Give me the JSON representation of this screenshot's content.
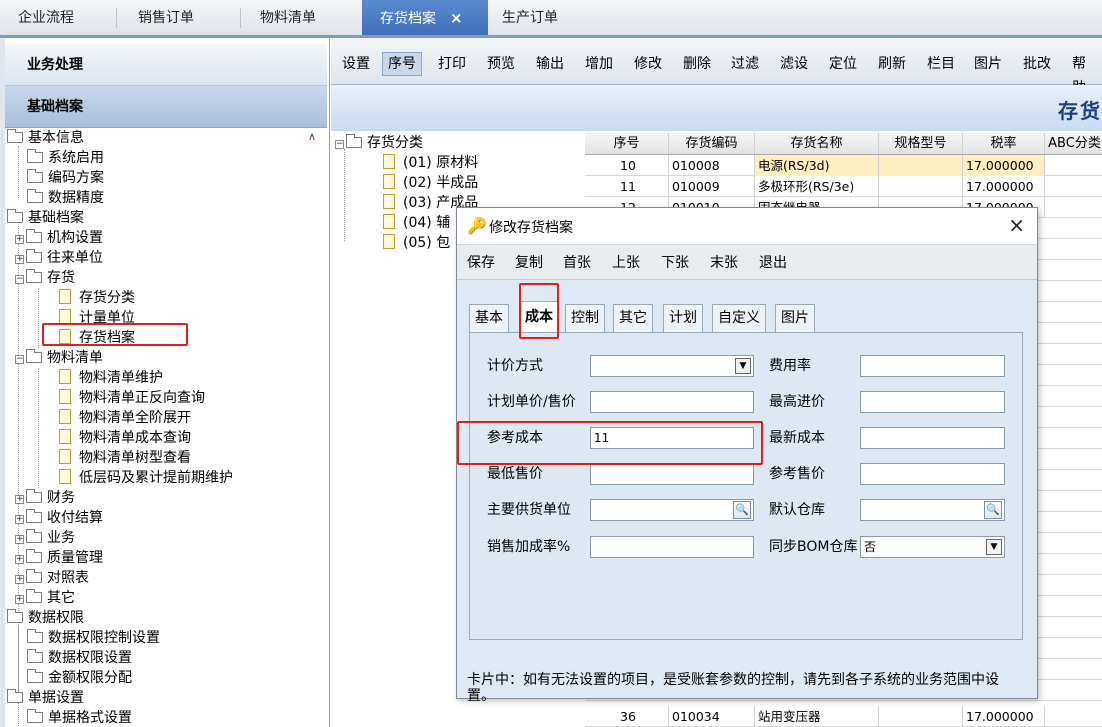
{
  "top_tabs": [
    {
      "label": "企业流程"
    },
    {
      "label": "销售订单"
    },
    {
      "label": "物料清单"
    },
    {
      "label": "存货档案",
      "active": true
    },
    {
      "label": "生产订单"
    }
  ],
  "close_glyph": "×",
  "nav": {
    "header1": "业务处理",
    "header2": "基础档案",
    "tree": [
      "基本信息",
      "系统启用",
      "编码方案",
      "数据精度",
      "基础档案",
      "机构设置",
      "往来单位",
      "存货",
      "存货分类",
      "计量单位",
      "存货档案",
      "物料清单",
      "物料清单维护",
      "物料清单正反向查询",
      "物料清单全阶展开",
      "物料清单成本查询",
      "物料清单树型查看",
      "低层码及累计提前期维护",
      "财务",
      "收付结算",
      "业务",
      "质量管理",
      "对照表",
      "其它",
      "数据权限",
      "数据权限控制设置",
      "数据权限设置",
      "金额权限分配",
      "单据设置",
      "单据格式设置"
    ]
  },
  "toolbar": [
    "设置",
    "序号",
    "打印",
    "预览",
    "输出",
    "增加",
    "修改",
    "删除",
    "过滤",
    "滤设",
    "定位",
    "刷新",
    "栏目",
    "图片",
    "批改",
    "帮助"
  ],
  "banner_title": "存货",
  "category_tree": {
    "root": "存货分类",
    "items": [
      "(01) 原材料",
      "(02) 半成品",
      "(03) 产成品",
      "(04) 辅",
      "(05) 包"
    ]
  },
  "grid": {
    "headers": [
      "序号",
      "存货编码",
      "存货名称",
      "规格型号",
      "税率",
      "ABC分类"
    ],
    "rows": [
      [
        "10",
        "010008",
        "电源(RS/3d)",
        "",
        "17.000000",
        ""
      ],
      [
        "11",
        "010009",
        "多极环形(RS/3e)",
        "",
        "17.000000",
        ""
      ],
      [
        "12",
        "010010",
        "固态继电器",
        "",
        "17.000000",
        ""
      ]
    ],
    "bottom_row": [
      "36",
      "010034",
      "站用变压器",
      "",
      "17.000000",
      ""
    ]
  },
  "dialog": {
    "title": "修改存货档案",
    "buttons": [
      "保存",
      "复制",
      "首张",
      "上张",
      "下张",
      "末张",
      "退出"
    ],
    "tabs": [
      "基本",
      "成本",
      "控制",
      "其它",
      "计划",
      "自定义",
      "图片"
    ],
    "fields": {
      "pricing_method": {
        "label": "计价方式",
        "value": ""
      },
      "expense_rate": {
        "label": "费用率",
        "value": ""
      },
      "plan_price": {
        "label": "计划单价/售价",
        "value": ""
      },
      "max_purchase_price": {
        "label": "最高进价",
        "value": ""
      },
      "ref_cost": {
        "label": "参考成本",
        "value": "11"
      },
      "latest_cost": {
        "label": "最新成本",
        "value": ""
      },
      "min_sale_price": {
        "label": "最低售价",
        "value": ""
      },
      "ref_sale_price": {
        "label": "参考售价",
        "value": ""
      },
      "main_supplier": {
        "label": "主要供货单位",
        "value": ""
      },
      "default_warehouse": {
        "label": "默认仓库",
        "value": ""
      },
      "sales_markup": {
        "label": "销售加成率%",
        "value": ""
      },
      "sync_bom_warehouse": {
        "label": "同步BOM仓库",
        "value": "否"
      }
    },
    "note": "卡片中：如有无法设置的项目，是受账套参数的控制，请先到各子系统的业务范围中设置。"
  },
  "colors": {
    "accent": "#3f6fb8",
    "highlight_box": "#e0201a"
  }
}
